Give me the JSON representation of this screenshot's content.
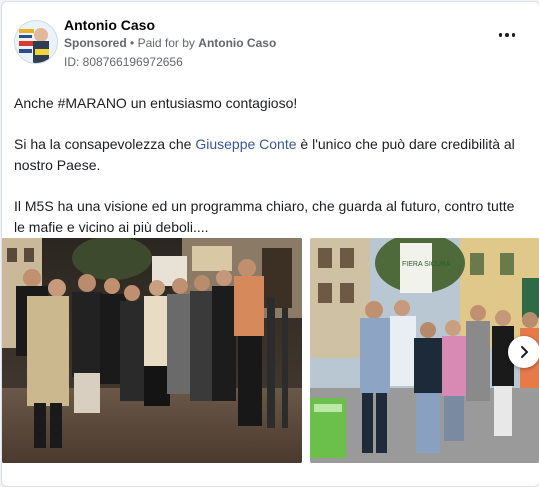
{
  "ad": {
    "page_name": "Antonio Caso",
    "sponsored_label": "Sponsored",
    "paid_by_prefix": "Paid for by",
    "paid_by_name": "Antonio Caso",
    "ad_id": "ID: 808766196972656"
  },
  "post": {
    "line1": "Anche #MARANO un entusiasmo contagioso!",
    "line2_before": "Si ha la consapevolezza che ",
    "line2_link": "Giuseppe Conte",
    "line2_after": " è l'unico che può dare credibilità al nostro Paese.",
    "line3": "Il M5S ha una visione ed un programma chiaro, che guarda al futuro, contro tutte le mafie e vicino ai più deboli...."
  },
  "photo2": {
    "sign_text": "FIERA SICURA"
  },
  "icons": {
    "more": "more-options-icon",
    "next": "chevron-right-icon"
  },
  "colors": {
    "link": "#385898",
    "text": "#1c1e21",
    "meta": "#65676b"
  }
}
